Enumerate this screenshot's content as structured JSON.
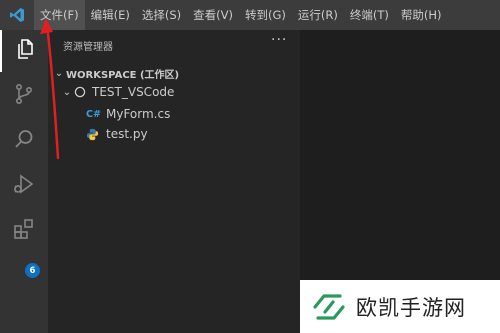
{
  "menubar": {
    "items": [
      {
        "label": "文件(F)"
      },
      {
        "label": "编辑(E)"
      },
      {
        "label": "选择(S)"
      },
      {
        "label": "查看(V)"
      },
      {
        "label": "转到(G)"
      },
      {
        "label": "运行(R)"
      },
      {
        "label": "终端(T)"
      },
      {
        "label": "帮助(H)"
      }
    ]
  },
  "activitybar": {
    "items": [
      {
        "icon": "files-icon"
      },
      {
        "icon": "source-control-icon"
      },
      {
        "icon": "search-icon"
      },
      {
        "icon": "run-debug-icon"
      },
      {
        "icon": "extensions-icon"
      }
    ],
    "extensions_badge": "6"
  },
  "sidebar": {
    "title": "资源管理器",
    "more": "···",
    "workspace": "WORKSPACE (工作区)",
    "folder": "TEST_VSCode",
    "files": [
      {
        "icon_text": "C#",
        "name": "MyForm.cs"
      },
      {
        "icon": "python-icon",
        "name": "test.py"
      }
    ]
  },
  "watermark": {
    "text": "欧凯手游网"
  },
  "colors": {
    "menubar": "#3c3c3c",
    "activitybar": "#333333",
    "sidebar": "#252526",
    "editor": "#1e1e1e",
    "accent_blue": "#0e70c0",
    "annotation_arrow": "#e02020"
  }
}
